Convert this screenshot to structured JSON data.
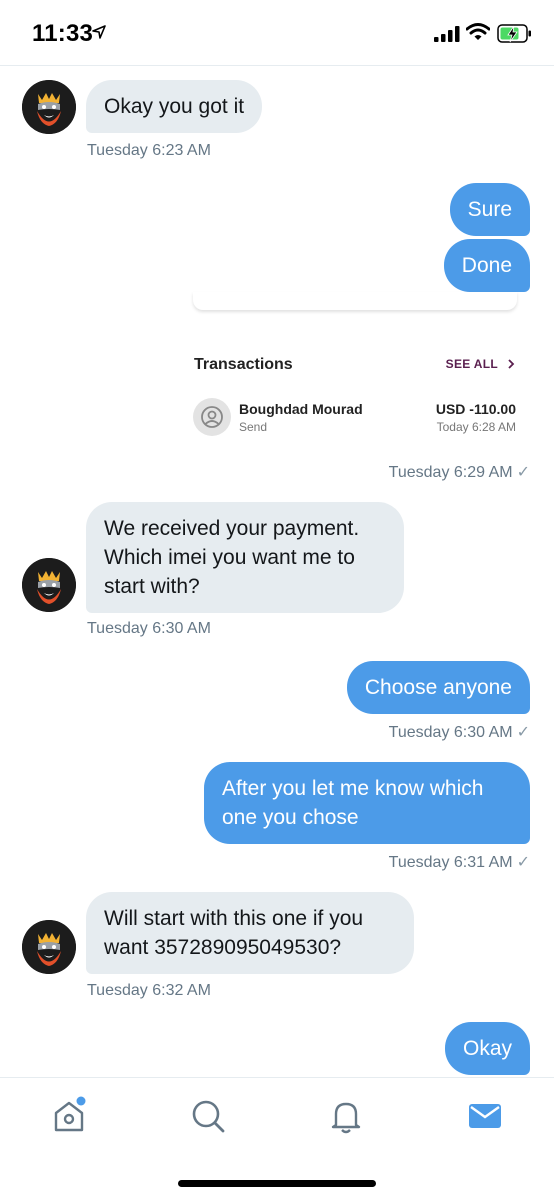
{
  "status_bar": {
    "time": "11:33"
  },
  "messages": {
    "m1": {
      "text": "Okay you got it",
      "time": "Tuesday 6:23 AM"
    },
    "m2": {
      "text": "Sure"
    },
    "m3": {
      "text": "Done"
    },
    "card": {
      "title": "Transactions",
      "see_all": "SEE ALL",
      "name": "Boughdad Mourad",
      "type": "Send",
      "amount": "USD -110.00",
      "date": "Today 6:28 AM",
      "time": "Tuesday 6:29 AM"
    },
    "m4": {
      "line1": "We received your payment.",
      "line2": "Which imei you want me to",
      "line3": "start with?",
      "time": "Tuesday 6:30 AM"
    },
    "m5": {
      "text": "Choose anyone",
      "time": "Tuesday 6:30 AM"
    },
    "m6": {
      "line1": "After you let me know which",
      "line2": "one you chose",
      "time": "Tuesday 6:31 AM"
    },
    "m7": {
      "line1": "Will start with this one if you",
      "line2": "want 357289095049530?",
      "time": "Tuesday 6:32 AM"
    },
    "m8": {
      "text": "Okay"
    }
  },
  "check_glyph": "✓",
  "colors": {
    "bubble_out": "#4c9be8",
    "bubble_in": "#e6ecf0",
    "tab_active": "#4c9be8",
    "notification_dot": "#4c9be8"
  }
}
